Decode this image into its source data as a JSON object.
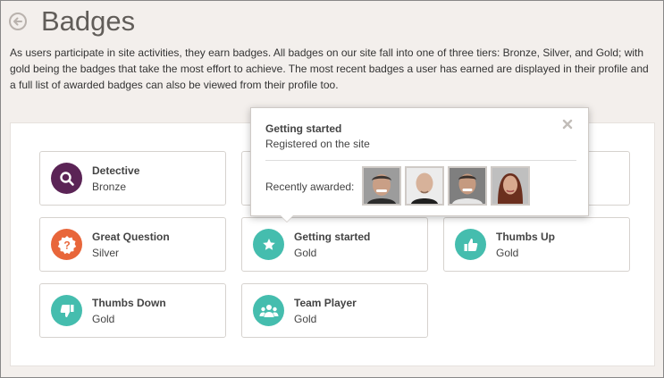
{
  "header": {
    "title": "Badges"
  },
  "intro": "As users participate in site activities, they earn badges. All badges on our site fall into one of three tiers: Bronze, Silver, and Gold; with gold being the badges that take the most effort to achieve. The most recent badges a user has earned are displayed in their profile and a full list of awarded badges can also be viewed from their profile too.",
  "badges": [
    {
      "name": "Detective",
      "tier": "Bronze",
      "icon": "search-icon",
      "color": "#5b2456"
    },
    {
      "name": "Great Question",
      "tier": "Silver",
      "icon": "question-icon",
      "color": "#e8663a"
    },
    {
      "name": "Getting started",
      "tier": "Gold",
      "icon": "star-icon",
      "color": "#45bdae"
    },
    {
      "name": "Thumbs Up",
      "tier": "Gold",
      "icon": "thumbs-up-icon",
      "color": "#45bdae"
    },
    {
      "name": "Thumbs Down",
      "tier": "Gold",
      "icon": "thumbs-down-icon",
      "color": "#45bdae"
    },
    {
      "name": "Team Player",
      "tier": "Gold",
      "icon": "team-icon",
      "color": "#45bdae"
    }
  ],
  "popover": {
    "title": "Getting started",
    "description": "Registered on the site",
    "recently_label": "Recently awarded:",
    "close_icon": "close-icon",
    "avatars": [
      "user-avatar-1",
      "user-avatar-2",
      "user-avatar-3",
      "user-avatar-4"
    ]
  }
}
